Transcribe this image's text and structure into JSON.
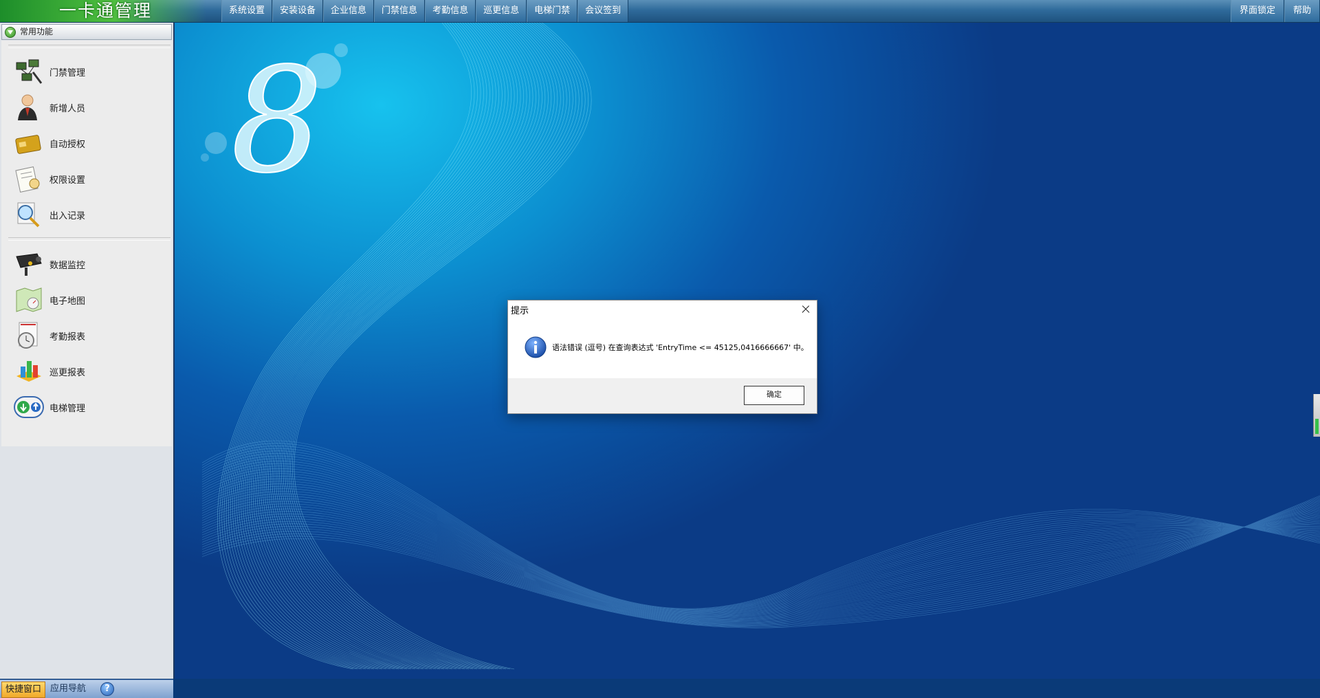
{
  "app": {
    "title": "一卡通管理"
  },
  "topnav": {
    "items": [
      "系统设置",
      "安装设备",
      "企业信息",
      "门禁信息",
      "考勤信息",
      "巡更信息",
      "电梯门禁",
      "会议签到"
    ],
    "right_items": [
      "界面锁定",
      "帮助"
    ]
  },
  "sidebar": {
    "header": "常用功能",
    "group1": [
      {
        "label": "门禁管理",
        "icon": "door-access-icon"
      },
      {
        "label": "新增人员",
        "icon": "person-icon"
      },
      {
        "label": "自动授权",
        "icon": "card-icon"
      },
      {
        "label": "权限设置",
        "icon": "permission-icon"
      },
      {
        "label": "出入记录",
        "icon": "search-record-icon"
      }
    ],
    "group2": [
      {
        "label": "数据监控",
        "icon": "camera-icon"
      },
      {
        "label": "电子地图",
        "icon": "map-icon"
      },
      {
        "label": "考勤报表",
        "icon": "clock-report-icon"
      },
      {
        "label": "巡更报表",
        "icon": "patrol-report-icon"
      },
      {
        "label": "电梯管理",
        "icon": "elevator-icon"
      }
    ],
    "tabs": {
      "quick": "快捷窗口",
      "nav": "应用导航",
      "help": "?"
    }
  },
  "dialog": {
    "title": "提示",
    "message": "语法错误 (逗号) 在查询表达式 'EntryTime <= 45125,0416666667' 中。",
    "ok_label": "确定"
  },
  "desktop": {
    "logo_text": "8"
  }
}
